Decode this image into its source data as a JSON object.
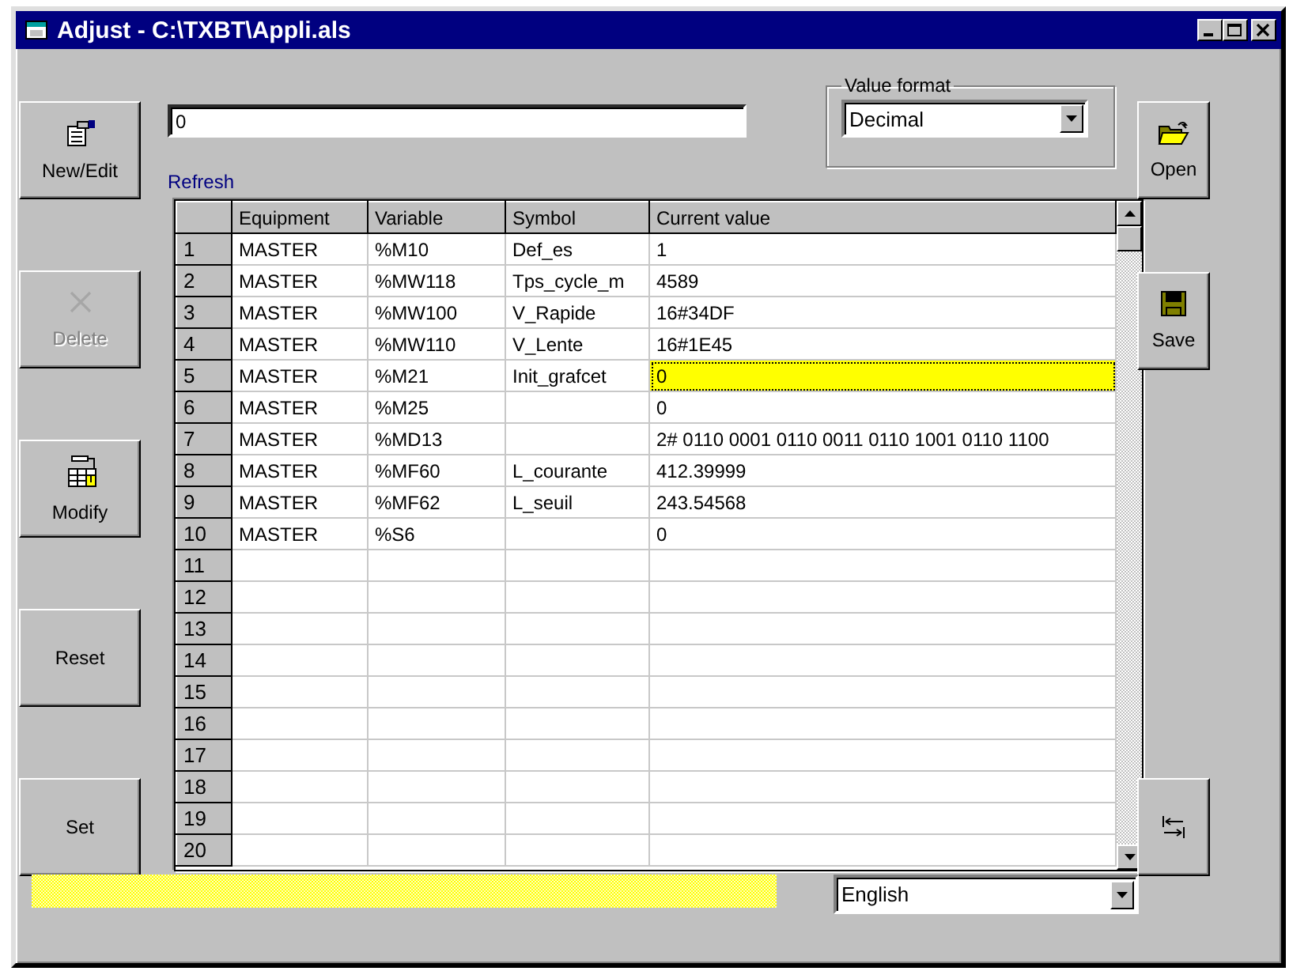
{
  "window": {
    "title": "Adjust - C:\\TXBT\\Appli.als"
  },
  "left_buttons": [
    {
      "label": "New/Edit",
      "disabled": false
    },
    {
      "label": "Delete",
      "disabled": true
    },
    {
      "label": "Modify",
      "disabled": false
    },
    {
      "label": "Reset",
      "disabled": false
    },
    {
      "label": "Set",
      "disabled": false
    }
  ],
  "right_buttons": [
    {
      "label": "Open",
      "disabled": false
    },
    {
      "label": "Save",
      "disabled": false
    },
    {
      "disabled": false
    }
  ],
  "value_field": {
    "value": "0"
  },
  "value_format": {
    "label": "Value format",
    "value": "Decimal"
  },
  "refresh_link": "Refresh",
  "table": {
    "columns": [
      "Equipment",
      "Variable",
      "Symbol",
      "Current value"
    ],
    "rows": [
      {
        "number": "1",
        "cells": [
          "MASTER",
          "%M10",
          "Def_es",
          "1"
        ],
        "selected": false
      },
      {
        "number": "2",
        "cells": [
          "MASTER",
          "%MW118",
          "Tps_cycle_m",
          "4589"
        ],
        "selected": false
      },
      {
        "number": "3",
        "cells": [
          "MASTER",
          "%MW100",
          "V_Rapide",
          "16#34DF"
        ],
        "selected": false
      },
      {
        "number": "4",
        "cells": [
          "MASTER",
          "%MW110",
          "V_Lente",
          "16#1E45"
        ],
        "selected": false
      },
      {
        "number": "5",
        "cells": [
          "MASTER",
          "%M21",
          "Init_grafcet",
          "0"
        ],
        "selected": true
      },
      {
        "number": "6",
        "cells": [
          "MASTER",
          "%M25",
          "",
          "0"
        ],
        "selected": false
      },
      {
        "number": "7",
        "cells": [
          "MASTER",
          "%MD13",
          "",
          "2# 0110 0001 0110 0011 0110 1001 0110 1100"
        ],
        "selected": false
      },
      {
        "number": "8",
        "cells": [
          "MASTER",
          "%MF60",
          "L_courante",
          "412.39999"
        ],
        "selected": false
      },
      {
        "number": "9",
        "cells": [
          "MASTER",
          "%MF62",
          "L_seuil",
          "243.54568"
        ],
        "selected": false
      },
      {
        "number": "10",
        "cells": [
          "MASTER",
          "%S6",
          "",
          "0"
        ],
        "selected": false
      },
      {
        "number": "11",
        "selected": false
      },
      {
        "number": "12",
        "selected": false
      },
      {
        "number": "13",
        "selected": false
      },
      {
        "number": "14",
        "selected": false
      },
      {
        "number": "15",
        "selected": false
      },
      {
        "number": "16",
        "selected": false
      },
      {
        "number": "17",
        "selected": false
      },
      {
        "number": "18",
        "selected": false
      },
      {
        "number": "19",
        "selected": false
      },
      {
        "number": "20",
        "selected": false
      }
    ]
  },
  "language": {
    "value": "English"
  }
}
